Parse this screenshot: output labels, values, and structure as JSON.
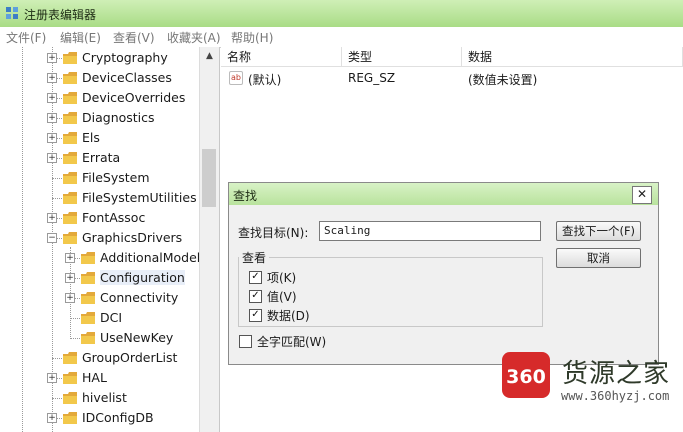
{
  "window": {
    "title": "注册表编辑器"
  },
  "menu": [
    "文件(F)",
    "编辑(E)",
    "查看(V)",
    "收藏夹(A)",
    "帮助(H)"
  ],
  "tree": {
    "items": [
      {
        "label": "Cryptography",
        "expandable": true,
        "level": 1
      },
      {
        "label": "DeviceClasses",
        "expandable": true,
        "level": 1
      },
      {
        "label": "DeviceOverrides",
        "expandable": true,
        "level": 1
      },
      {
        "label": "Diagnostics",
        "expandable": true,
        "level": 1
      },
      {
        "label": "Els",
        "expandable": true,
        "level": 1
      },
      {
        "label": "Errata",
        "expandable": true,
        "level": 1
      },
      {
        "label": "FileSystem",
        "expandable": false,
        "level": 1
      },
      {
        "label": "FileSystemUtilities",
        "expandable": false,
        "level": 1
      },
      {
        "label": "FontAssoc",
        "expandable": true,
        "level": 1
      },
      {
        "label": "GraphicsDrivers",
        "expandable": "open",
        "level": 1
      },
      {
        "label": "AdditionalModel",
        "expandable": true,
        "level": 2
      },
      {
        "label": "Configuration",
        "expandable": true,
        "level": 2,
        "selected": true
      },
      {
        "label": "Connectivity",
        "expandable": true,
        "level": 2
      },
      {
        "label": "DCI",
        "expandable": false,
        "level": 2
      },
      {
        "label": "UseNewKey",
        "expandable": false,
        "level": 2
      },
      {
        "label": "GroupOrderList",
        "expandable": false,
        "level": 1
      },
      {
        "label": "HAL",
        "expandable": true,
        "level": 1
      },
      {
        "label": "hivelist",
        "expandable": false,
        "level": 1
      },
      {
        "label": "IDConfigDB",
        "expandable": true,
        "level": 1
      }
    ]
  },
  "list": {
    "columns": {
      "name": "名称",
      "type": "类型",
      "data": "数据"
    },
    "rows": [
      {
        "icon": "ab",
        "name": "(默认)",
        "type": "REG_SZ",
        "data": "(数值未设置)"
      }
    ]
  },
  "find_dialog": {
    "title": "查找",
    "close": "✕",
    "target_label": "查找目标(N):",
    "target_value": "Scaling",
    "find_next": "查找下一个(F)",
    "cancel": "取消",
    "look_at_label": "查看",
    "options": [
      {
        "label": "项(K)",
        "checked": true
      },
      {
        "label": "值(V)",
        "checked": true
      },
      {
        "label": "数据(D)",
        "checked": true
      }
    ],
    "match_whole": {
      "label": "全字匹配(W)",
      "checked": false
    }
  },
  "watermark": {
    "logo": "360",
    "name": "货源之家",
    "url": "www.360hyzj.com"
  },
  "colors": {
    "titlebar": "#b9e39d",
    "dialog_bg": "#f0f0f0",
    "folder": "#f2c84b",
    "watermark_red": "#d62a2a"
  }
}
